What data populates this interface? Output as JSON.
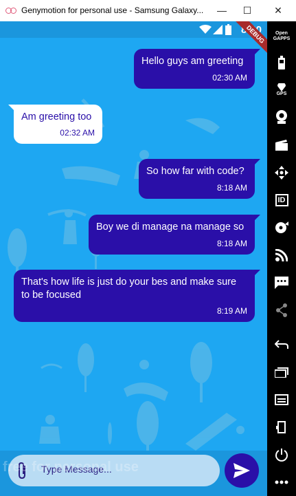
{
  "window": {
    "title": "Genymotion for personal use - Samsung Galaxy...",
    "minimize": "—",
    "maximize": "☐",
    "close": "✕"
  },
  "status_bar": {
    "time": "8:20",
    "debug_label": "DEBUG"
  },
  "messages": [
    {
      "direction": "outgoing",
      "text": "Hello guys am greeting",
      "time": "02:30 AM"
    },
    {
      "direction": "incoming",
      "text": "Am greeting too",
      "time": "02:32 AM"
    },
    {
      "direction": "outgoing",
      "text": "So how far with code?",
      "time": "8:18 AM"
    },
    {
      "direction": "outgoing",
      "text": "Boy we di manage na manage so",
      "time": "8:18 AM"
    },
    {
      "direction": "outgoing",
      "text": "That's how life is just do your bes and make sure to be focused",
      "time": "8:19 AM"
    }
  ],
  "composer": {
    "placeholder": "Type Message...",
    "attach_icon": "paperclip-icon",
    "send_icon": "send-icon"
  },
  "watermark": "free for personal use",
  "toolbar": {
    "open_gapps": "Open GAPPS",
    "gps": "GPS",
    "id": "ID",
    "icons": [
      "open-gapps-icon",
      "battery-icon",
      "gps-icon",
      "webcam-icon",
      "clapper-icon",
      "dpad-icon",
      "id-icon",
      "disk-icon",
      "rss-icon",
      "sms-icon",
      "share-icon",
      "back-icon",
      "recent-apps-icon",
      "menu-icon",
      "volume-down-icon",
      "power-icon",
      "more-icon"
    ]
  },
  "colors": {
    "screen_bg": "#1ea7f2",
    "bubble_out": "#2a0fa8",
    "bubble_in": "#ffffff",
    "toolbar_bg": "#000000"
  }
}
